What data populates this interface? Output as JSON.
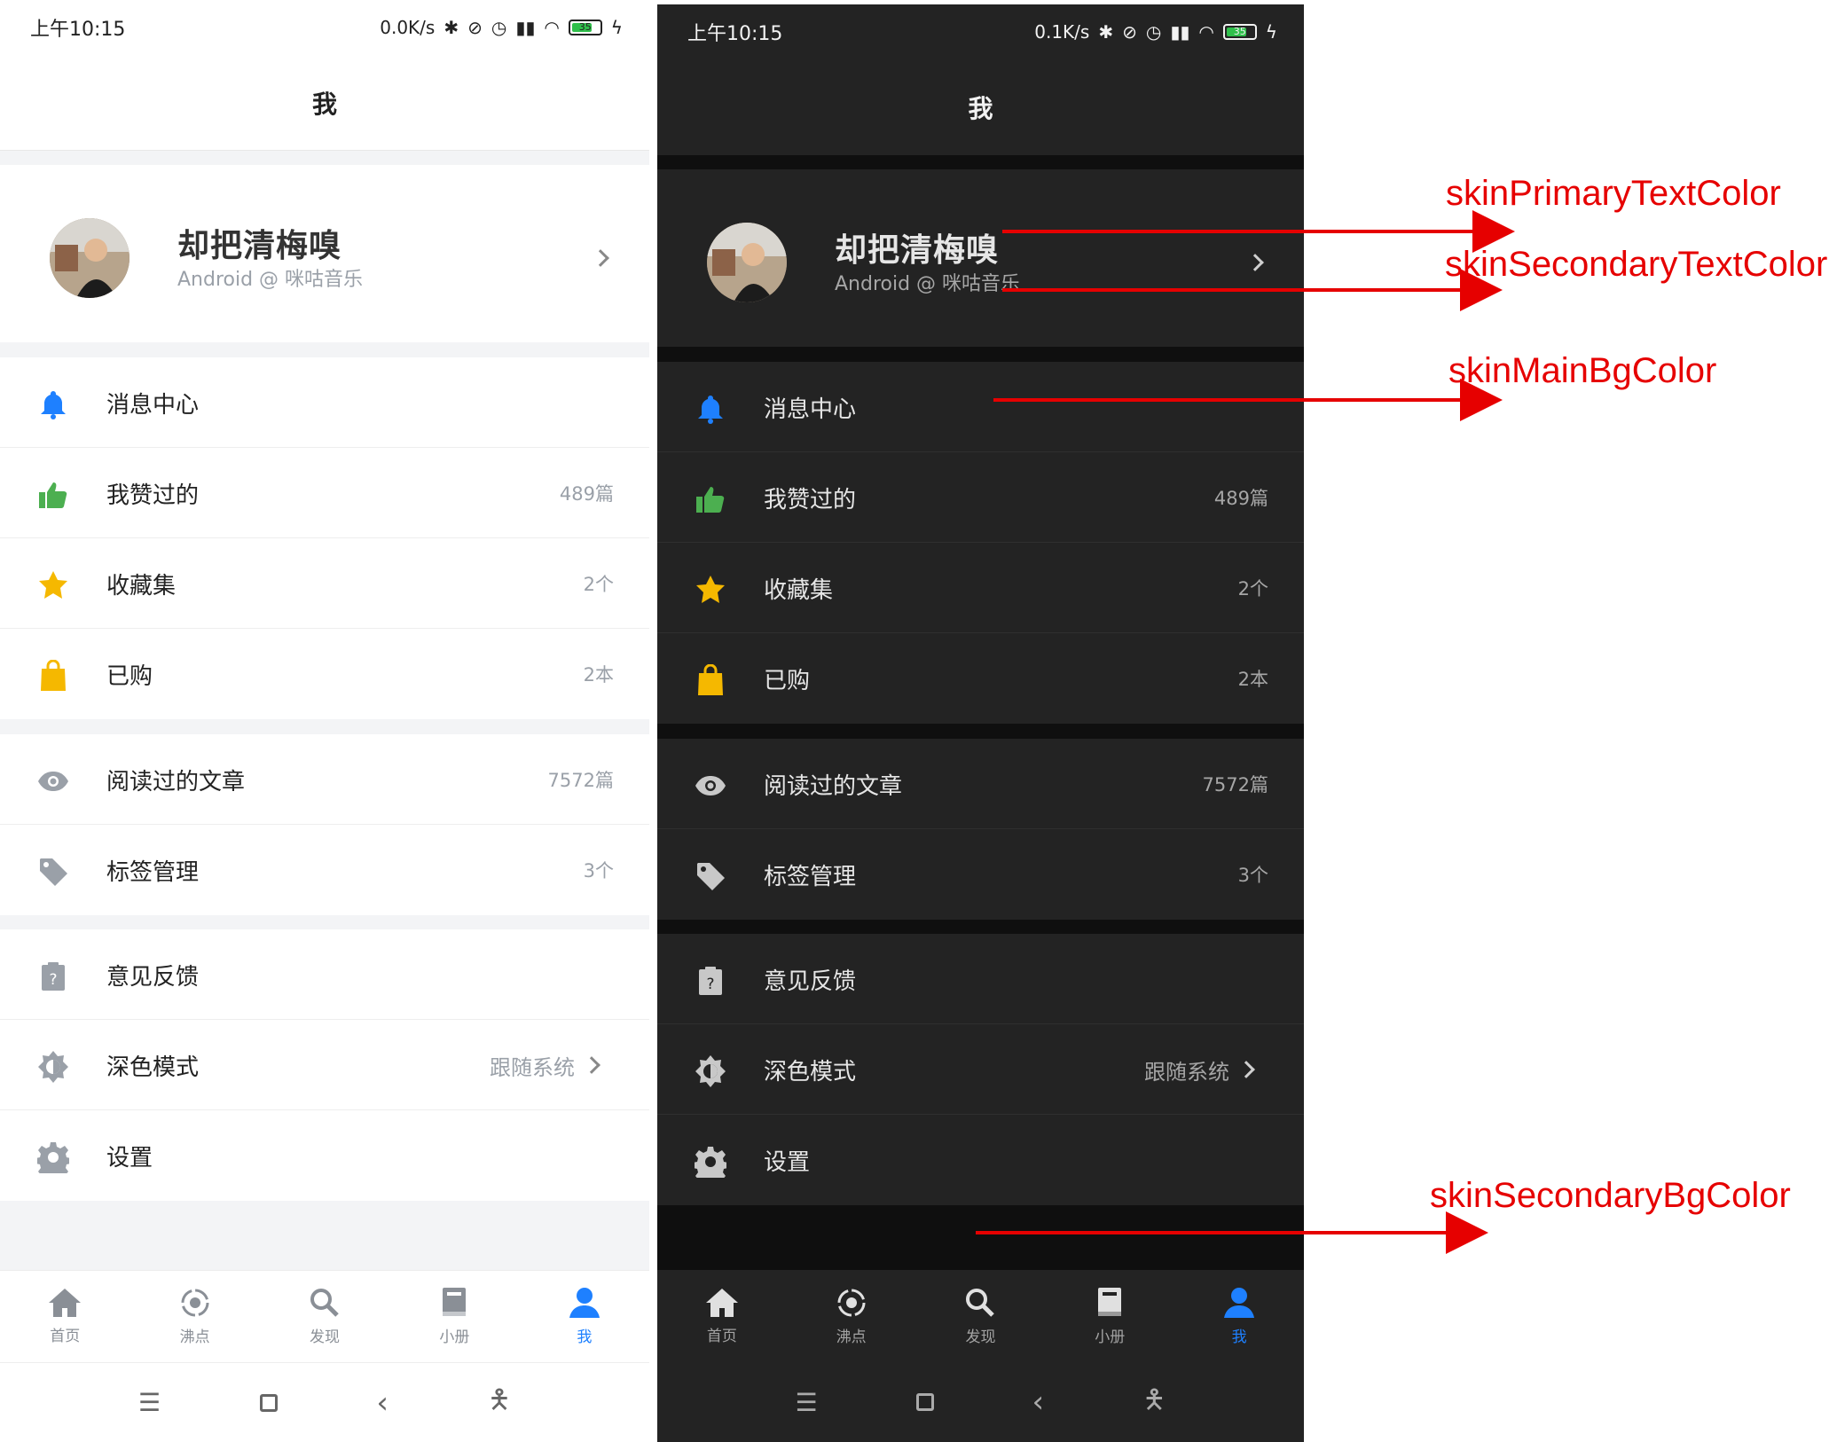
{
  "status_light": {
    "time": "上午10:15",
    "speed": "0.0K/s",
    "battery": "35"
  },
  "status_dark": {
    "time": "上午10:15",
    "speed": "0.1K/s",
    "battery": "35"
  },
  "page_title": "我",
  "profile": {
    "name": "却把清梅嗅",
    "subtitle": "Android @ 咪咕音乐"
  },
  "menu": {
    "messages": {
      "label": "消息中心",
      "icon": "bell-icon"
    },
    "liked": {
      "label": "我赞过的",
      "value": "489篇",
      "icon": "thumbs-up-icon"
    },
    "collections": {
      "label": "收藏集",
      "value": "2个",
      "icon": "star-icon"
    },
    "purchased": {
      "label": "已购",
      "value": "2本",
      "icon": "shopping-bag-icon"
    },
    "read": {
      "label": "阅读过的文章",
      "value": "7572篇",
      "icon": "eye-icon"
    },
    "tags": {
      "label": "标签管理",
      "value": "3个",
      "icon": "tag-icon"
    },
    "feedback": {
      "label": "意见反馈",
      "icon": "feedback-clipboard-icon"
    },
    "dark_mode": {
      "label": "深色模式",
      "value": "跟随系统",
      "icon": "dark-mode-icon"
    },
    "settings": {
      "label": "设置",
      "icon": "gear-icon"
    }
  },
  "tabs": [
    {
      "label": "首页",
      "icon": "home-icon"
    },
    {
      "label": "沸点",
      "icon": "boiling-point-icon"
    },
    {
      "label": "发现",
      "icon": "search-icon"
    },
    {
      "label": "小册",
      "icon": "booklet-icon"
    },
    {
      "label": "我",
      "icon": "user-icon",
      "active": true
    }
  ],
  "annotations": {
    "primary_text": "skinPrimaryTextColor",
    "secondary_text": "skinSecondaryTextColor",
    "main_bg": "skinMainBgColor",
    "secondary_bg": "skinSecondaryBgColor"
  },
  "colors": {
    "accent": "#1e80ff",
    "annotation": "#e60000",
    "bell": "#1e80ff",
    "thumbs_up": "#4caf50",
    "star": "#f5b800",
    "bag": "#f5b800",
    "gray_icon": "#9aa0a8"
  }
}
